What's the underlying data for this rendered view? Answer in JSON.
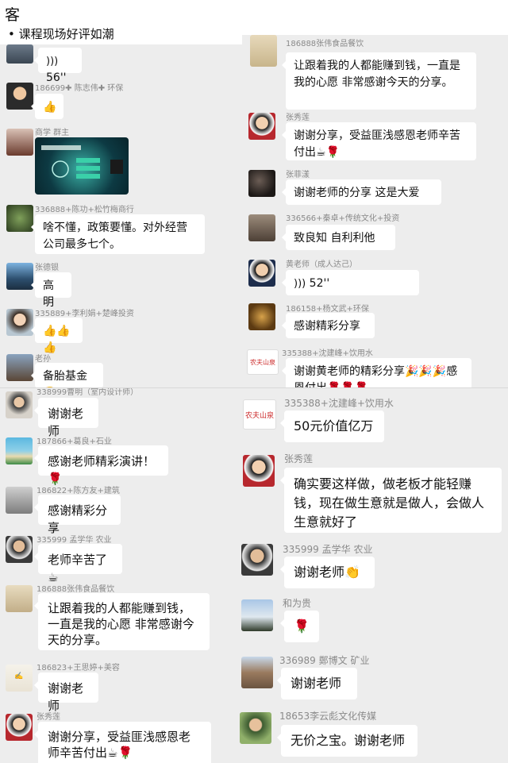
{
  "header": {
    "title": "客",
    "subtitle": "• 课程现场好评如潮"
  },
  "colors": {
    "accent_red": "#cc2b2b",
    "bubble_bg": "#ffffff",
    "chat_bg": "#ededed"
  },
  "left_top": [
    {
      "sender": "",
      "text": "56''",
      "type": "voice"
    },
    {
      "sender": "186699✚ 陈志伟✚ 环保",
      "text": "👍",
      "type": "text"
    },
    {
      "sender": "商学 群主",
      "text": "",
      "type": "image"
    },
    {
      "sender": "336888+陈功+松竹梅商行",
      "text": "啥不懂，政策要懂。对外经营公司最多七个。",
      "type": "text"
    },
    {
      "sender": "张德银",
      "text": "高明",
      "type": "text"
    },
    {
      "sender": "335889+李利娟+楚峰投资",
      "text": "👍👍👍",
      "type": "text"
    },
    {
      "sender": "老孙",
      "text": "备胎基金🤩",
      "type": "text"
    }
  ],
  "right_top": [
    {
      "sender": "186888张伟食品餐饮",
      "text": "让跟着我的人都能赚到钱，一直是我的心愿 非常感谢今天的分享。"
    },
    {
      "sender": "张秀莲",
      "text": "谢谢分享，受益匪浅感恩老师辛苦付出☕🌹"
    },
    {
      "sender": "张菲漾",
      "text": "谢谢老师的分享 这是大爱"
    },
    {
      "sender": "336566+秦卓+传统文化+投资",
      "text": "致良知 自利利他"
    },
    {
      "sender": "黄老师（成人达己）",
      "text": "52''"
    },
    {
      "sender": "186158+杨文武+环保",
      "text": "感谢精彩分享"
    },
    {
      "sender": "335388+沈建峰+饮用水",
      "text": "谢谢黄老师的精彩分享🎉🎉🎉感恩付出🌹🌹🌹"
    }
  ],
  "left_bottom": [
    {
      "sender": "338999曹明（室内设计师）",
      "text": "谢谢老师"
    },
    {
      "sender": "187866+葛良+石业",
      "text": "感谢老师精彩演讲！🌹"
    },
    {
      "sender": "186822+陈方友+建筑",
      "text": "感谢精彩分享"
    },
    {
      "sender": "335999  孟学华  农业",
      "text": "老师辛苦了☕"
    },
    {
      "sender": "186888张伟食品餐饮",
      "text": "让跟着我的人都能赚到钱，一直是我的心愿 非常感谢今天的分享。"
    },
    {
      "sender": "186823+王思婷+美容",
      "text": "谢谢老师"
    },
    {
      "sender": "张秀莲",
      "text": "谢谢分享，受益匪浅感恩老师辛苦付出☕🌹"
    }
  ],
  "right_bottom": [
    {
      "sender": "335388+沈建峰+饮用水",
      "text": "50元价值亿万"
    },
    {
      "sender": "张秀莲",
      "text": "确实要这样做，做老板才能轻赚钱，现在做生意就是做人，会做人生意就好了"
    },
    {
      "sender": "335999  孟学华  农业",
      "text": "谢谢老师👏"
    },
    {
      "sender": "和为贵",
      "text": "🌹"
    },
    {
      "sender": "336989 鄭博文 矿业",
      "text": "谢谢老师"
    },
    {
      "sender": "18653李云彪文化传媒",
      "text": "无价之宝。谢谢老师"
    }
  ],
  "logo_text": "农夫山泉"
}
